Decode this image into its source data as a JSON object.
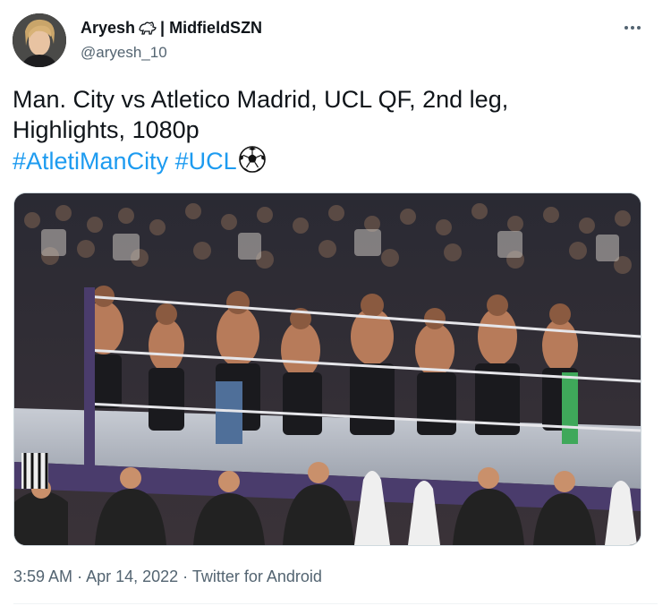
{
  "tweet": {
    "display_name": "Aryesh",
    "display_name_suffix": "| MidfieldSZN",
    "name_emoji_icon": "lion-icon",
    "handle": "@aryesh_10",
    "more_icon": "more-dots-icon",
    "text_line_1": "Man. City vs Atletico Madrid, UCL QF, 2nd leg,",
    "text_line_2": "Highlights, 1080p",
    "hashtag_1": "#AtletiManCity",
    "hashtag_2": "#UCL",
    "hashtag_emoji_icon": "soccer-ball-icon",
    "media_alt": "wrestling-ring-brawl-photo",
    "time": "3:59 AM",
    "separator": "·",
    "date": "Apr 14, 2022",
    "source": "Twitter for Android"
  },
  "colors": {
    "text_primary": "#0f1419",
    "text_secondary": "#536471",
    "link": "#1d9bf0"
  }
}
